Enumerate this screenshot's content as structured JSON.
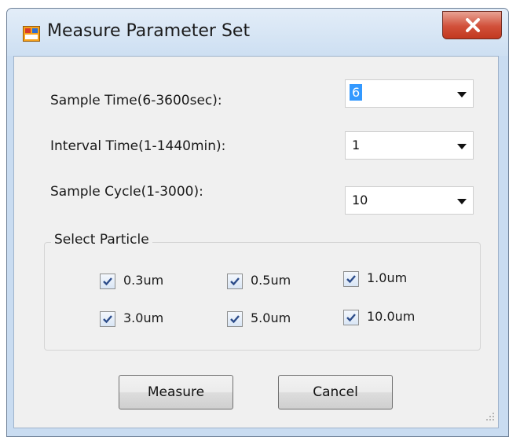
{
  "window": {
    "title": "Measure Parameter Set",
    "icon": "form-icon",
    "close_icon": "close-x-icon"
  },
  "fields": [
    {
      "label": "Sample Time(6-3600sec):",
      "value": "6",
      "selected": true
    },
    {
      "label": "Interval Time(1-1440min):",
      "value": "1",
      "selected": false
    },
    {
      "label": "Sample Cycle(1-3000):",
      "value": "10",
      "selected": false
    }
  ],
  "particle_group": {
    "title": "Select Particle",
    "options": [
      {
        "label": "0.3um",
        "checked": true
      },
      {
        "label": "0.5um",
        "checked": true
      },
      {
        "label": "1.0um",
        "checked": true
      },
      {
        "label": "3.0um",
        "checked": true
      },
      {
        "label": "5.0um",
        "checked": true
      },
      {
        "label": "10.0um",
        "checked": true
      }
    ]
  },
  "buttons": {
    "measure": "Measure",
    "cancel": "Cancel"
  },
  "colors": {
    "titlebar": "#cddff2",
    "close_button": "#c9452f",
    "selection": "#3399ff",
    "client": "#f0f0f0"
  }
}
